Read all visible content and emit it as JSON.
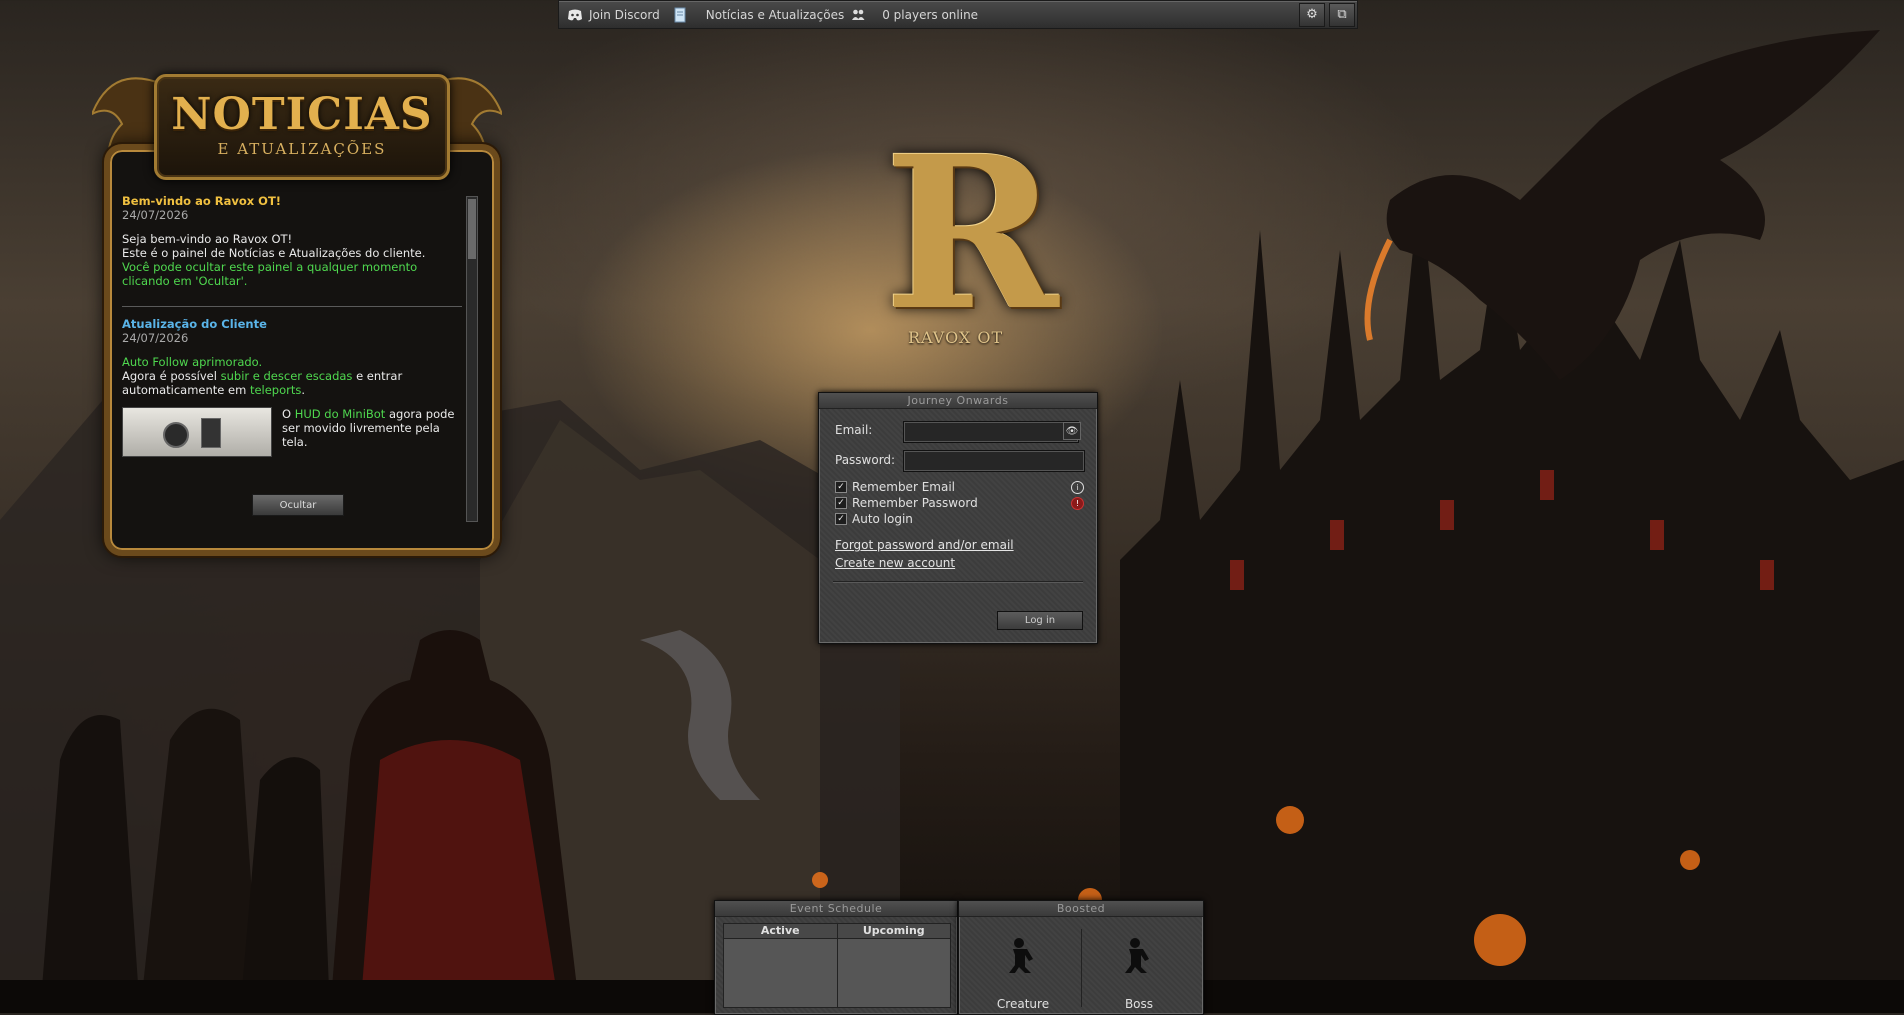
{
  "topbar": {
    "discord_label": "Join Discord",
    "news_label": "Notícias e Atualizações",
    "players_online": "0 players online"
  },
  "news": {
    "title": "NOTICIAS",
    "subtitle": "E ATUALIZAÇÕES",
    "articles": [
      {
        "title": "Bem-vindo ao Ravox OT!",
        "date": "24/07/2026",
        "lines": [
          "Seja bem-vindo ao Ravox OT!",
          "Este é o painel de Notícias e Atualizações do cliente."
        ],
        "highlight": "Você pode ocultar este painel a qualquer momento clicando em 'Ocultar'."
      },
      {
        "title": "Atualização do Cliente",
        "date": "24/07/2026",
        "highlight": "Auto Follow aprimorado.",
        "p1_before": "Agora é possível ",
        "p1_hl1": "subir e descer escadas",
        "p1_mid": " e entrar automaticamente em ",
        "p1_hl2": "teleports",
        "p1_end": ".",
        "p2_before": "O ",
        "p2_hl": "HUD do MiniBot",
        "p2_after": " agora pode ser movido livremente pela tela."
      }
    ],
    "hide_button": "Ocultar"
  },
  "logo": {
    "text": "RAVOX OT",
    "letter": "R"
  },
  "login": {
    "title": "Journey Onwards",
    "email_label": "Email:",
    "email_value": "",
    "password_label": "Password:",
    "password_value": "",
    "remember_email": "Remember Email",
    "remember_password": "Remember Password",
    "auto_login": "Auto login",
    "forgot_link": "Forgot password and/or email",
    "create_link": "Create new account",
    "login_button": "Log in",
    "check_mark": "✓"
  },
  "events": {
    "title": "Event Schedule",
    "col_active": "Active",
    "col_upcoming": "Upcoming"
  },
  "boosted": {
    "title": "Boosted",
    "creature": "Creature",
    "boss": "Boss"
  },
  "colors": {
    "gold": "#f0c040",
    "blue": "#5ab4e8",
    "green": "#4fd84f",
    "panel": "#3e3e3e"
  }
}
